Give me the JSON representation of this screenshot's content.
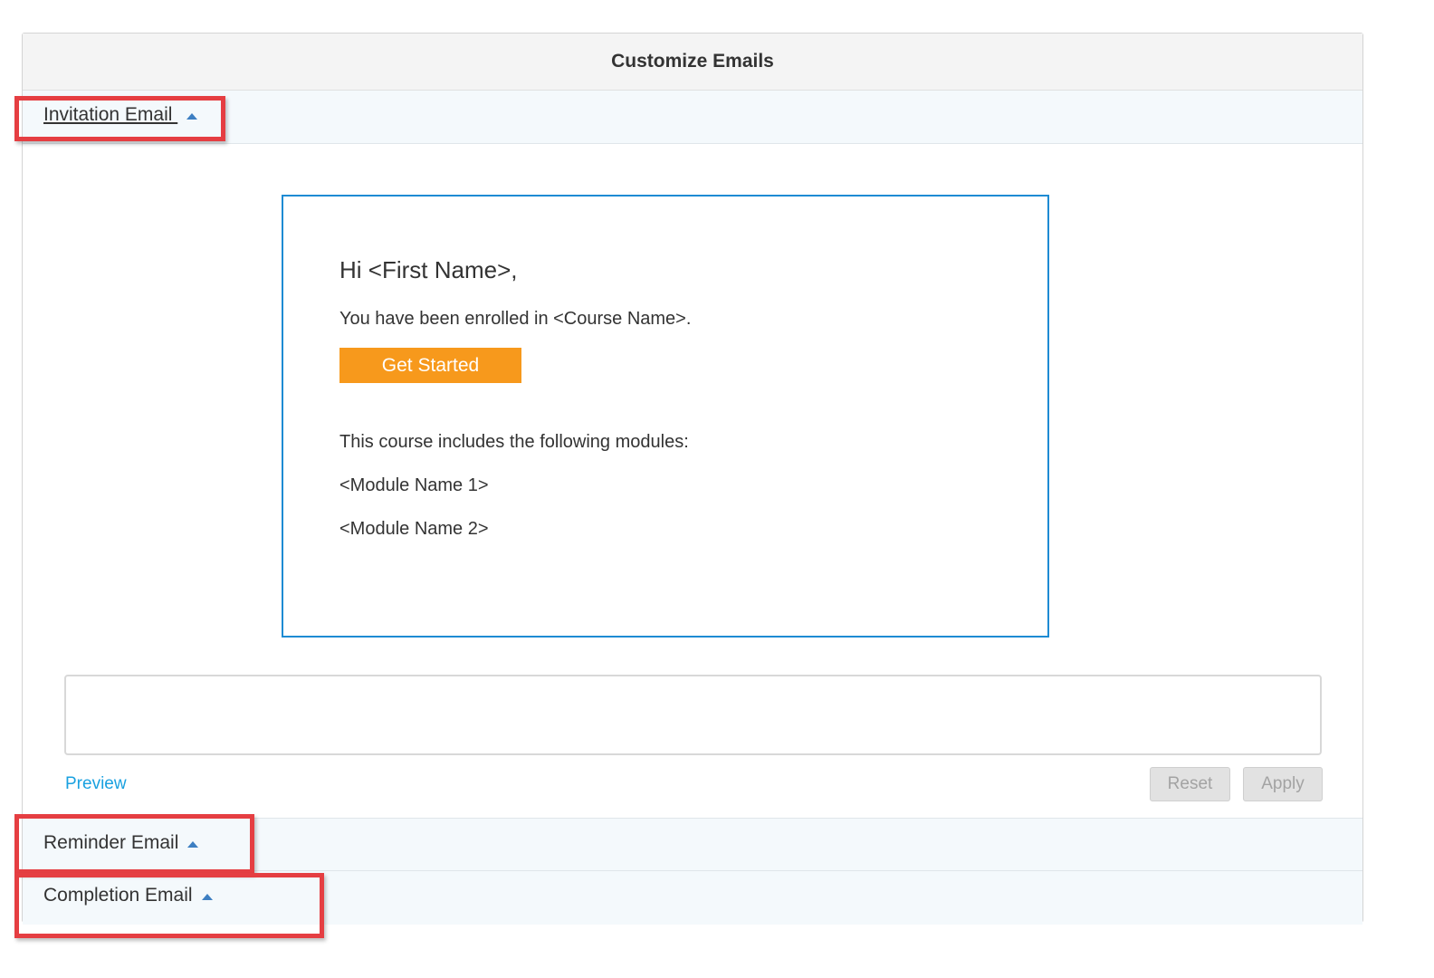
{
  "panel": {
    "title": "Customize Emails"
  },
  "sections": {
    "invitation": {
      "label": "Invitation Email "
    },
    "reminder": {
      "label": "Reminder Email"
    },
    "completion": {
      "label": "Completion Email"
    }
  },
  "email": {
    "greeting": "Hi <First Name>,",
    "enrolled": "You have been enrolled in <Course Name>.",
    "cta_label": "Get Started",
    "modules_intro": "This course includes the following modules:",
    "modules": [
      "<Module Name 1>",
      "<Module Name 2>"
    ]
  },
  "editor": {
    "body_value": "",
    "preview_label": "Preview",
    "reset_label": "Reset",
    "apply_label": "Apply"
  },
  "colors": {
    "cta_orange": "#f7991c",
    "preview_border": "#1e8bd3",
    "link_blue": "#1aa1e0",
    "highlight_red": "#e53e42"
  },
  "icons": {
    "caret": "caret-up-icon"
  }
}
